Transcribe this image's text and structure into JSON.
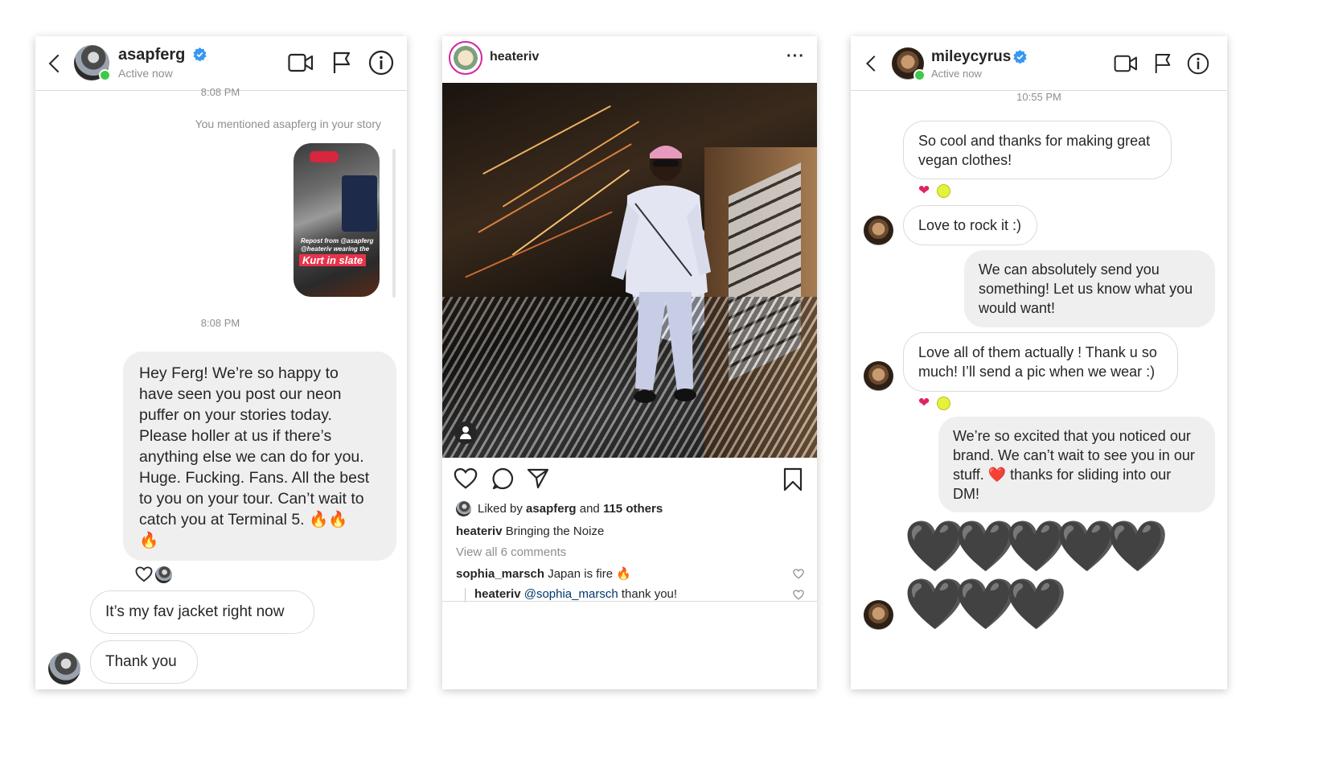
{
  "panel1": {
    "username": "asapferg",
    "status": "Active now",
    "cut_timestamp": "8:08 PM",
    "story_mention": "You mentioned asapferg in your story",
    "story_caption_line1": "Repost from @asapferg",
    "story_caption_line2": "@heateriv wearing the",
    "story_caption_highlight": "Kurt in slate",
    "timestamp": "8:08 PM",
    "sent_message": "Hey Ferg! We’re so happy to have seen you post our neon puffer on your stories today. Please holler at us if there’s anything else we can do for you. Huge. Fucking. Fans. All the best to you on your tour. Can’t wait to catch you at Terminal 5. 🔥🔥 🔥",
    "sent_lines": [
      "Hey Ferg! We’re so happy to",
      "have seen you post our neon",
      "puffer on your stories today.",
      "Please holler at us if there’s",
      "anything else we can do for you.",
      "Huge. Fucking. Fans. All the best",
      "to you on your tour. Can’t wait to",
      "catch you at Terminal 5. 🔥🔥",
      "🔥"
    ],
    "reply1": "It’s my fav jacket right now",
    "reply2": "Thank you"
  },
  "panel2": {
    "username": "heateriv",
    "more_icon": "···",
    "liked_by_prefix": "Liked by ",
    "liked_by_user": "asapferg",
    "liked_by_and": " and ",
    "liked_by_others": "115 others",
    "caption_user": "heateriv",
    "caption_text": " Bringing the Noize",
    "view_comments": "View all 6 comments",
    "comment1_user": "sophia_marsch",
    "comment1_text": " Japan is fire 🔥",
    "comment2_user": "heateriv",
    "comment2_mention": "@sophia_marsch",
    "comment2_text": " thank you!"
  },
  "panel3": {
    "username": "mileycyrus",
    "status": "Active now",
    "timestamp": "10:55 PM",
    "msg1_lines": [
      "So cool and thanks for making great",
      "vegan clothes!"
    ],
    "msg2": "Love to rock it :)",
    "msg3_lines": [
      "We can absolutely send you",
      "something! Let us know what you",
      "would want!"
    ],
    "msg4_lines": [
      "Love all of them actually ! Thank u so",
      "much! I’ll send a pic when we wear :)"
    ],
    "msg5_lines": [
      "We’re so excited that you noticed our",
      "brand. We can’t wait to see you in our",
      "stuff. ❤️ thanks for sliding into our",
      "DM!"
    ],
    "hearts_row1": [
      "🖤",
      "🖤",
      "🖤",
      "🖤",
      "🖤"
    ],
    "hearts_row2": [
      "🖤",
      "🖤",
      "🖤"
    ]
  },
  "colors": {
    "verified_blue": "#3897f0",
    "online_green": "#3fc94b",
    "outgoing_bubble": "#efefef",
    "reaction_heart": "#e0245e",
    "link": "#00376b"
  }
}
